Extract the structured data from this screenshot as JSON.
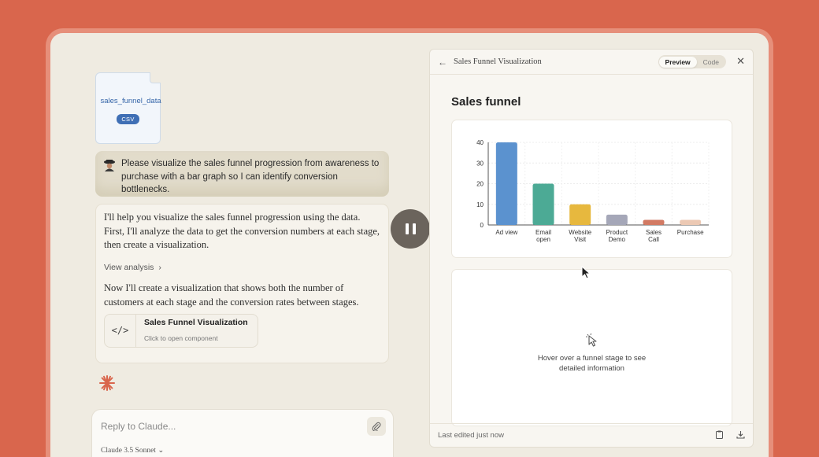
{
  "file": {
    "name": "sales_funnel_data",
    "type": "CSV"
  },
  "user_message": "Please visualize the sales funnel progression from awareness to purchase with a bar graph so I can identify conversion bottlenecks.",
  "assistant": {
    "paragraph1": "I'll help you visualize the sales funnel progression using the data. First, I'll analyze the data to get the conversion numbers at each stage, then create a visualization.",
    "view_analysis": "View analysis",
    "paragraph2": "Now I'll create a visualization that shows both the number of customers at each stage and the conversion rates between stages.",
    "component": {
      "title": "Sales Funnel Visualization",
      "subtitle": "Click to open component"
    }
  },
  "reply": {
    "placeholder": "Reply to Claude...",
    "model": "Claude 3.5 Sonnet"
  },
  "panel": {
    "title": "Sales Funnel Visualization",
    "tabs": [
      "Preview",
      "Code"
    ],
    "active_tab": "Preview",
    "content_title": "Sales funnel",
    "info_text": "Hover over a funnel stage to see detailed information",
    "footer": "Last edited just now"
  },
  "chart_data": {
    "type": "bar",
    "categories": [
      "Ad view",
      "Email open",
      "Website Visit",
      "Product Demo",
      "Sales Call",
      "Purchase"
    ],
    "values": [
      40,
      20,
      10,
      5,
      2.5,
      2.5
    ],
    "colors": [
      "#5b92cf",
      "#4caa95",
      "#e7b83e",
      "#a5a7b8",
      "#d27a63",
      "#ecc9b4"
    ],
    "ylim": [
      0,
      40
    ],
    "yticks": [
      0,
      10,
      20,
      30,
      40
    ],
    "grid": true
  }
}
